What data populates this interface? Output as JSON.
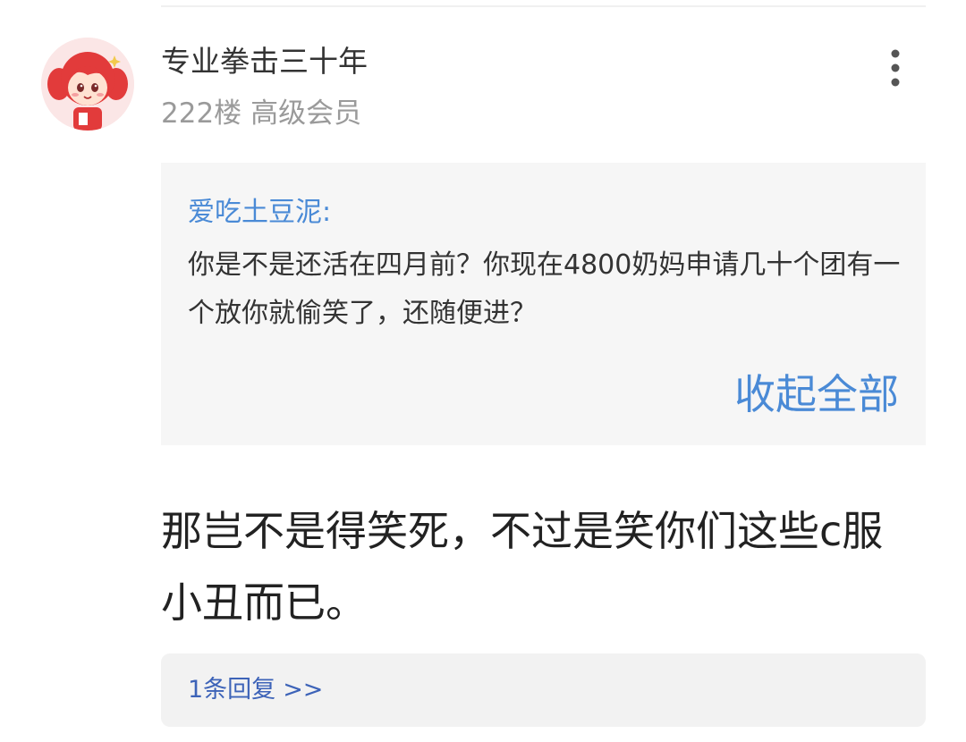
{
  "post": {
    "username": "专业拳击三十年",
    "floor": "222楼",
    "member_level": "高级会员",
    "more_icon": "more-vertical-icon",
    "quote": {
      "author": "爱吃土豆泥:",
      "text": "你是不是还活在四月前？你现在4800奶妈申请几十个团有一个放你就偷笑了，还随便进？",
      "collapse_label": "收起全部"
    },
    "content": "那岂不是得笑死，不过是笑你们这些c服小丑而已。",
    "replies": {
      "label": "1条回复",
      "arrow": ">>"
    }
  },
  "colors": {
    "link_blue": "#4a8ad6",
    "reply_blue": "#3d63b8",
    "meta_gray": "#9a9a9a",
    "quote_bg": "#f6f6f6",
    "avatar_bg": "#fbe6e6"
  }
}
